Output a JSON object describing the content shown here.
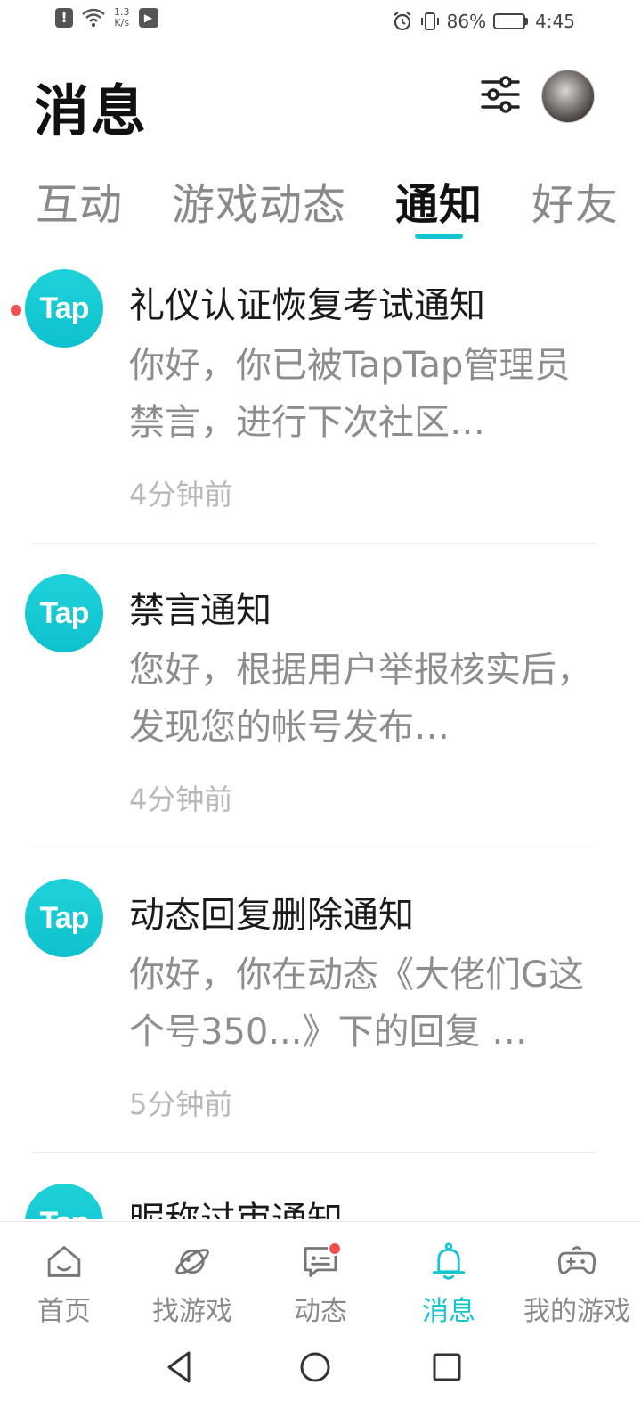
{
  "status_bar": {
    "network_speed_value": "1.3",
    "network_speed_unit": "K/s",
    "battery": "86%",
    "battery_level": 0.86,
    "time": "4:45"
  },
  "header": {
    "title": "消息"
  },
  "tabs": [
    {
      "label": "互动",
      "active": false
    },
    {
      "label": "游戏动态",
      "active": false
    },
    {
      "label": "通知",
      "active": true
    },
    {
      "label": "好友",
      "active": false
    }
  ],
  "notifications": [
    {
      "logo_text": "Tap",
      "title": "礼仪认证恢复考试通知",
      "body": "你好，你已被TapTap管理员禁言，进行下次社区…",
      "time": "4分钟前",
      "unread": true
    },
    {
      "logo_text": "Tap",
      "title": "禁言通知",
      "body": "您好，根据用户举报核实后，发现您的帐号发布…",
      "time": "4分钟前",
      "unread": false
    },
    {
      "logo_text": "Tap",
      "title": "动态回复删除通知",
      "body": "你好，你在动态《大佬们G这个号350...》下的回复 …",
      "time": "5分钟前",
      "unread": false
    },
    {
      "logo_text": "Tap",
      "title": "昵称过审通知",
      "body": "",
      "time": "",
      "unread": false
    }
  ],
  "bottom_nav": [
    {
      "label": "首页",
      "icon": "home-icon",
      "active": false
    },
    {
      "label": "找游戏",
      "icon": "planet-icon",
      "active": false
    },
    {
      "label": "动态",
      "icon": "chat-icon",
      "active": false,
      "badge": true
    },
    {
      "label": "消息",
      "icon": "bell-icon",
      "active": true
    },
    {
      "label": "我的游戏",
      "icon": "gamepad-icon",
      "active": false
    }
  ],
  "colors": {
    "accent": "#15c5ce",
    "unread": "#f25050",
    "muted_text": "#8d8d8d"
  }
}
